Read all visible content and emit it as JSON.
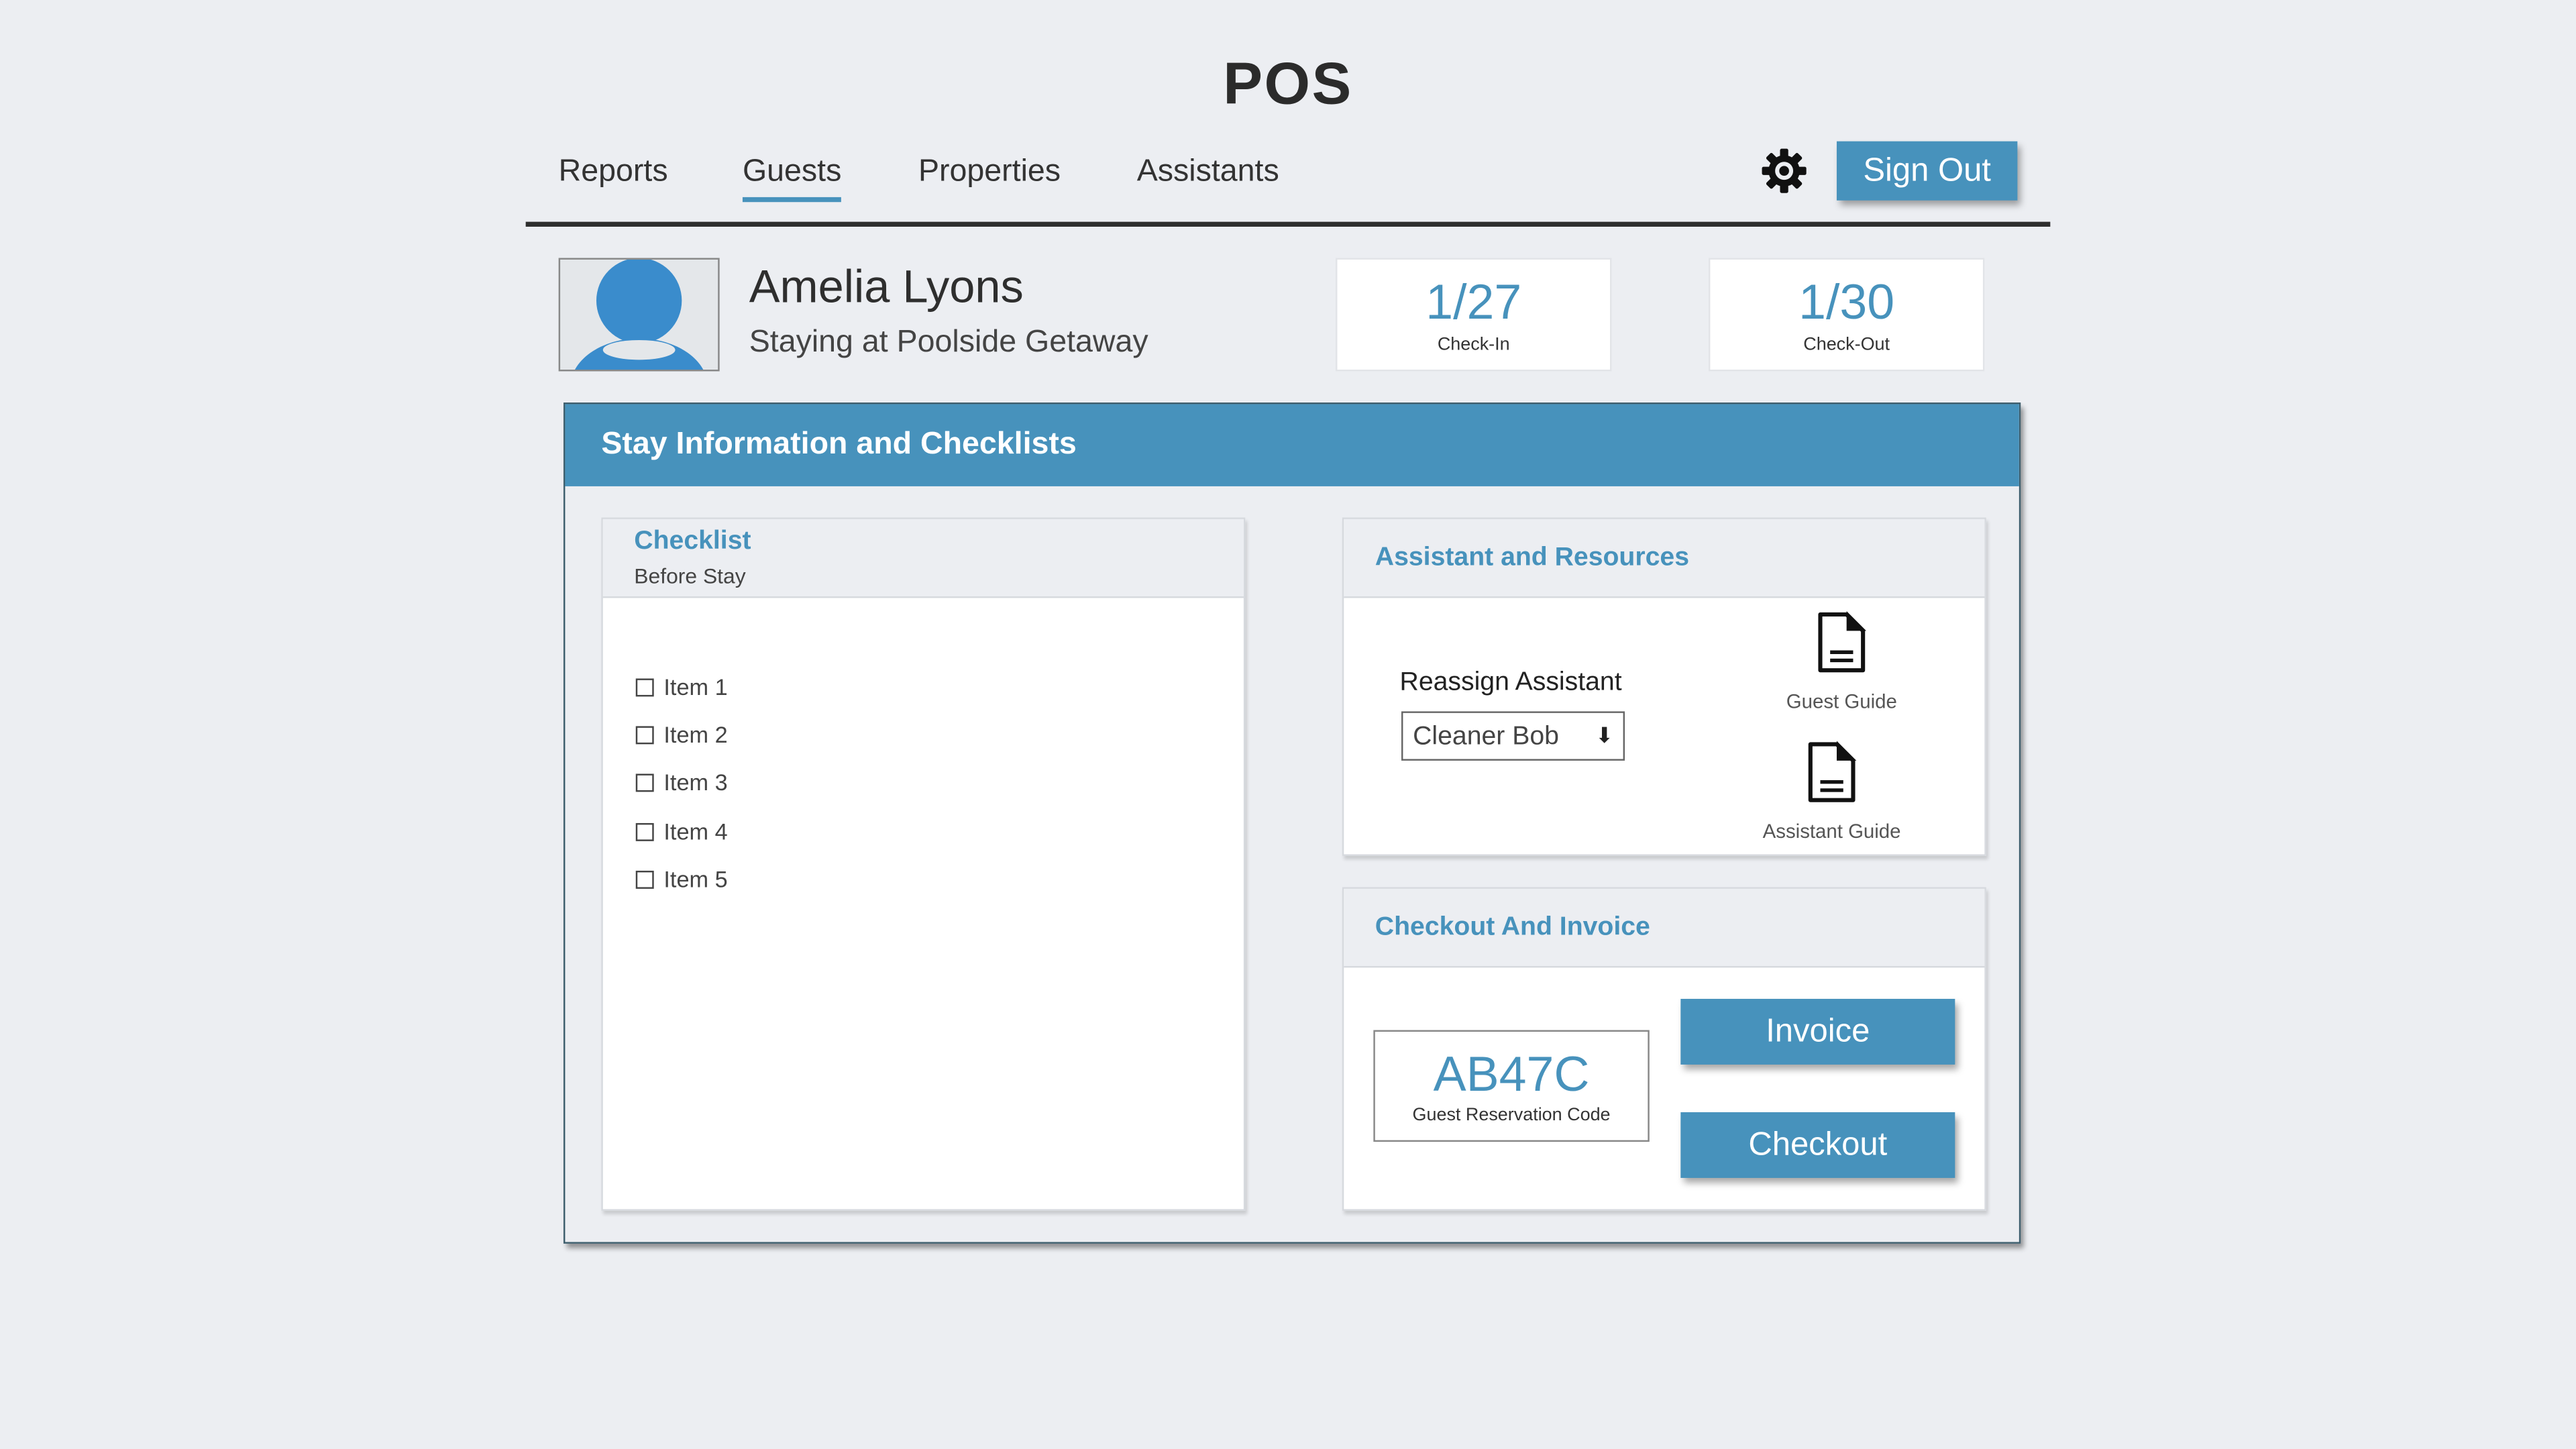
{
  "app": {
    "title": "POS"
  },
  "nav": {
    "items": [
      {
        "label": "Reports"
      },
      {
        "label": "Guests",
        "active": true
      },
      {
        "label": "Properties"
      },
      {
        "label": "Assistants"
      }
    ],
    "settings_icon": "gear-icon",
    "sign_out_label": "Sign Out"
  },
  "guest": {
    "name": "Amelia Lyons",
    "subtitle": "Staying at Poolside Getaway",
    "avatar_icon": "user-avatar-icon",
    "check_in": {
      "value": "1/27",
      "label": "Check-In"
    },
    "check_out": {
      "value": "1/30",
      "label": "Check-Out"
    }
  },
  "stay_panel": {
    "title": "Stay Information and Checklists",
    "checklist": {
      "title": "Checklist",
      "subtitle": "Before Stay",
      "items": [
        "Item 1",
        "Item 2",
        "Item 3",
        "Item 4",
        "Item 5"
      ]
    },
    "assistant": {
      "title": "Assistant and Resources",
      "reassign_label": "Reassign Assistant",
      "selected_assistant": "Cleaner Bob",
      "dropdown_arrow": "⬇",
      "resources": [
        {
          "label": "Guest Guide",
          "icon": "document-icon"
        },
        {
          "label": "Assistant Guide",
          "icon": "document-icon"
        }
      ]
    },
    "checkout": {
      "title": "Checkout And Invoice",
      "reservation_code": "AB47C",
      "reservation_label": "Guest Reservation Code",
      "invoice_label": "Invoice",
      "checkout_label": "Checkout"
    }
  },
  "colors": {
    "accent": "#4792bc",
    "background": "#eceef2",
    "card": "#ffffff",
    "text": "#333333"
  }
}
